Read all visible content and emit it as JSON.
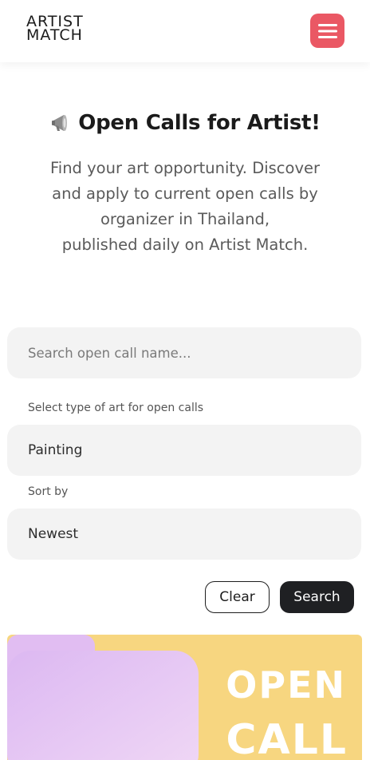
{
  "header": {
    "logo_line1": "ARTIST",
    "logo_line2": "MATCH",
    "menu_icon": "hamburger-menu-icon",
    "menu_color": "#ea5864"
  },
  "hero": {
    "icon": "megaphone-icon",
    "title": "Open Calls for Artist!",
    "subtitle_lines": [
      "Find your art opportunity. Discover",
      "and apply to current open calls by",
      "organizer in Thailand,",
      "published daily on Artist Match."
    ]
  },
  "filters": {
    "search_placeholder": "Search open call name...",
    "type_label": "Select type of art for open calls",
    "type_value": "Painting",
    "sort_label": "Sort by",
    "sort_value": "Newest"
  },
  "actions": {
    "clear_label": "Clear",
    "search_label": "Search"
  },
  "banner": {
    "line1": "OPEN",
    "line2": "CALL",
    "bg_color": "#f7d680"
  }
}
